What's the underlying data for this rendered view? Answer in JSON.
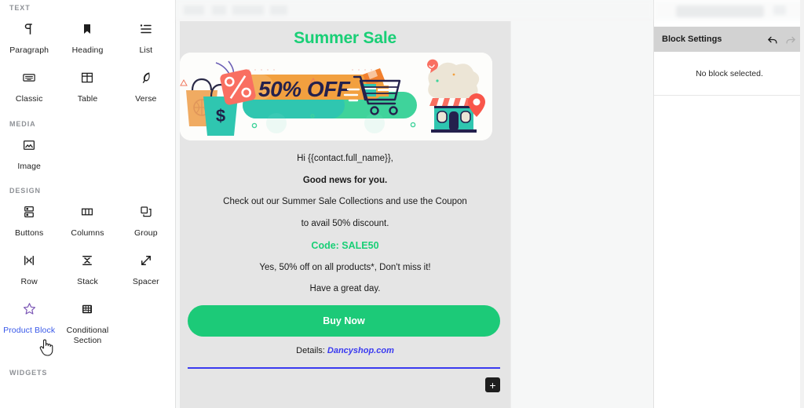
{
  "sidebar": {
    "sections": [
      {
        "label": "TEXT",
        "items": [
          {
            "label": "Paragraph",
            "icon": "paragraph-icon",
            "active": false
          },
          {
            "label": "Heading",
            "icon": "heading-icon",
            "active": false
          },
          {
            "label": "List",
            "icon": "list-icon",
            "active": false
          },
          {
            "label": "Classic",
            "icon": "classic-icon",
            "active": false
          },
          {
            "label": "Table",
            "icon": "table-icon",
            "active": false
          },
          {
            "label": "Verse",
            "icon": "verse-icon",
            "active": false
          }
        ]
      },
      {
        "label": "MEDIA",
        "items": [
          {
            "label": "Image",
            "icon": "image-icon",
            "active": false
          }
        ]
      },
      {
        "label": "DESIGN",
        "items": [
          {
            "label": "Buttons",
            "icon": "buttons-icon",
            "active": false
          },
          {
            "label": "Columns",
            "icon": "columns-icon",
            "active": false
          },
          {
            "label": "Group",
            "icon": "group-icon",
            "active": false
          },
          {
            "label": "Row",
            "icon": "row-icon",
            "active": false
          },
          {
            "label": "Stack",
            "icon": "stack-icon",
            "active": false
          },
          {
            "label": "Spacer",
            "icon": "spacer-icon",
            "active": false
          },
          {
            "label": "Product Block",
            "icon": "star-icon",
            "active": true
          },
          {
            "label": "Conditional Section",
            "icon": "conditional-section-icon",
            "active": false
          }
        ]
      },
      {
        "label": "WIDGETS",
        "items": []
      }
    ]
  },
  "email": {
    "title": "Summer Sale",
    "banner": {
      "headline": "50% OFF",
      "alt": "summer sale banner with shopping bags, discount tag, cart and storefront"
    },
    "lines": [
      {
        "text": "Hi {{contact.full_name}},",
        "style": "normal"
      },
      {
        "text": "Good news for you.",
        "style": "bold"
      },
      {
        "text": "Check out our Summer Sale Collections and use the Coupon",
        "style": "normal"
      },
      {
        "text": "to avail 50% discount.",
        "style": "normal"
      },
      {
        "text": "Code: SALE50",
        "style": "code"
      },
      {
        "text": "Yes, 50% off on all products*, Don't miss it!",
        "style": "normal"
      },
      {
        "text": "Have a great day.",
        "style": "normal"
      }
    ],
    "cta_label": "Buy Now",
    "details_prefix": "Details:",
    "details_link": "Dancyshop.com",
    "appender_label": "+"
  },
  "right_panel": {
    "title": "Block Settings",
    "empty_message": "No block selected.",
    "undo_icon": "undo-icon",
    "redo_icon": "redo-icon"
  },
  "colors": {
    "accent_green": "#19cf76",
    "cta_green": "#1cca78",
    "link_blue": "#3a3af0",
    "active_blue": "#3858e9",
    "canvas_gray": "#e5e5e5",
    "panel_header_gray": "#d2d2d2"
  }
}
